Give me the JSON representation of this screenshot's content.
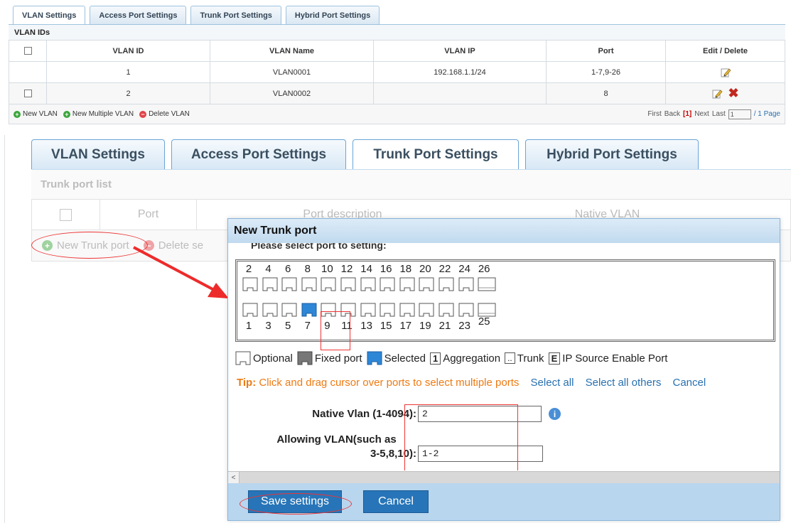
{
  "top": {
    "tabs": [
      "VLAN Settings",
      "Access Port Settings",
      "Trunk Port Settings",
      "Hybrid Port Settings"
    ],
    "section_title": "VLAN IDs",
    "columns": [
      "VLAN ID",
      "VLAN Name",
      "VLAN IP",
      "Port",
      "Edit / Delete"
    ],
    "rows": [
      {
        "id": "1",
        "name": "VLAN0001",
        "ip": "192.168.1.1/24",
        "port": "1-7,9-26"
      },
      {
        "id": "2",
        "name": "VLAN0002",
        "ip": "",
        "port": "8"
      }
    ],
    "actions": {
      "new_vlan": "New VLAN",
      "new_multiple": "New Multiple VLAN",
      "delete_vlan": "Delete VLAN"
    },
    "pager": {
      "first": "First",
      "back": "Back",
      "current": "[1]",
      "next": "Next",
      "last": "Last",
      "page_input": "1",
      "total": "/ 1 Page"
    }
  },
  "main": {
    "tabs": [
      "VLAN Settings",
      "Access Port Settings",
      "Trunk Port Settings",
      "Hybrid Port Settings"
    ],
    "list_title": "Trunk port list",
    "columns": {
      "port": "Port",
      "description": "Port description",
      "native": "Native VLAN"
    },
    "actions": {
      "new_trunk": "New Trunk port",
      "delete": "Delete se"
    }
  },
  "dialog": {
    "title": "New Trunk port",
    "prompt": "Please select port to setting:",
    "top_ports": [
      "2",
      "4",
      "6",
      "8",
      "10",
      "12",
      "14",
      "16",
      "18",
      "20",
      "22",
      "24",
      "26"
    ],
    "bottom_ports": [
      "1",
      "3",
      "5",
      "7",
      "9",
      "11",
      "13",
      "15",
      "17",
      "19",
      "21",
      "23",
      "25"
    ],
    "selected_port": "7",
    "legend": {
      "optional": "Optional",
      "fixed": "Fixed port",
      "selected": "Selected",
      "aggregation_num": "1",
      "aggregation": "Aggregation",
      "trunk_mark": "..",
      "trunk": "Trunk",
      "ip_mark": "E",
      "ip_source": "IP Source Enable Port"
    },
    "tip": {
      "label": "Tip:",
      "text": "Click and drag cursor over ports to select multiple ports",
      "select_all": "Select all",
      "select_others": "Select all others",
      "cancel": "Cancel"
    },
    "native_label": "Native Vlan (1-4094):",
    "native_value": "2",
    "allow_label_1": "Allowing VLAN(such as",
    "allow_label_2": "3-5,8,10):",
    "allow_value": "1-2",
    "scroll_arrow": "<",
    "save_label": "Save settings",
    "cancel_label": "Cancel"
  },
  "colors": {
    "accent": "#2775b8",
    "selected_port": "#2e86d7",
    "annotation": "#ee3333",
    "tip": "#ee7a12"
  }
}
